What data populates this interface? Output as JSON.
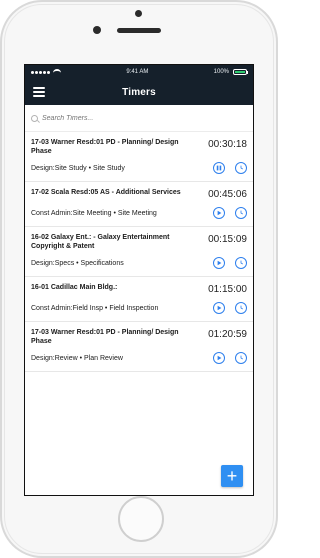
{
  "status": {
    "time": "9:41 AM",
    "battery": "100%"
  },
  "header": {
    "title": "Timers"
  },
  "search": {
    "placeholder": "Search Timers..."
  },
  "timers": [
    {
      "title": "17-03 Warner Resd:01 PD - Planning/ Design Phase",
      "time": "00:30:18",
      "desc": "Design:Site Study • Site Study",
      "state": "paused"
    },
    {
      "title": "17-02 Scala Resd:05 AS - Additional Services",
      "time": "00:45:06",
      "desc": "Const Admin:Site Meeting • Site Meeting",
      "state": "stopped"
    },
    {
      "title": "16-02 Galaxy Ent.: - Galaxy Entertainment Copyright & Patent",
      "time": "00:15:09",
      "desc": "Design:Specs • Specifications",
      "state": "stopped"
    },
    {
      "title": "16-01 Cadillac Main Bldg.:",
      "time": "01:15:00",
      "desc": "Const Admin:Field Insp • Field Inspection",
      "state": "stopped"
    },
    {
      "title": "17-03 Warner Resd:01 PD - Planning/ Design Phase",
      "time": "01:20:59",
      "desc": "Design:Review • Plan Review",
      "state": "stopped"
    }
  ],
  "fab": {
    "label": "+"
  },
  "icons": {
    "menu": "hamburger-menu-icon",
    "search": "search-icon",
    "pause": "pause-icon",
    "play": "play-icon",
    "clock": "clock-icon",
    "add": "plus-icon"
  },
  "colors": {
    "header_bg": "#15202b",
    "accent": "#2f80ed",
    "fab": "#2f8ff2"
  }
}
